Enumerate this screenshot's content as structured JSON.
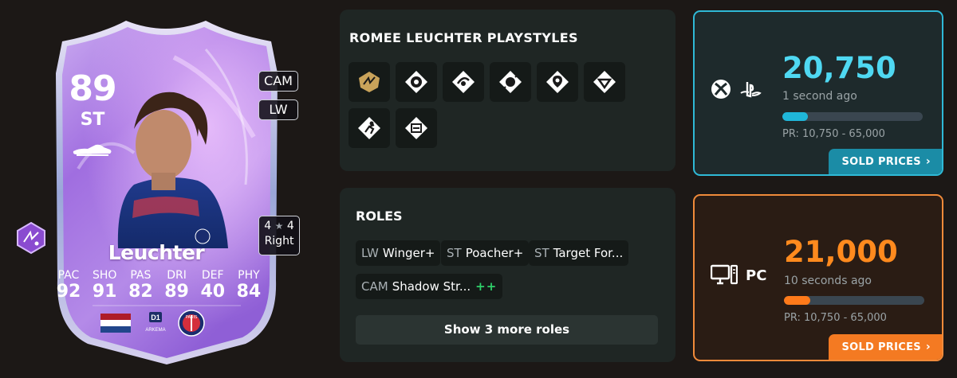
{
  "card": {
    "rating": "89",
    "position": "ST",
    "alt_positions": [
      "CAM",
      "LW"
    ],
    "skill_moves": "4",
    "weak_foot": "4",
    "star_glyph": "★",
    "foot": "Right",
    "name": "Leuchter",
    "stats": [
      {
        "label": "PAC",
        "value": "92"
      },
      {
        "label": "SHO",
        "value": "91"
      },
      {
        "label": "PAS",
        "value": "82"
      },
      {
        "label": "DRI",
        "value": "89"
      },
      {
        "label": "DEF",
        "value": "40"
      },
      {
        "label": "PHY",
        "value": "84"
      }
    ],
    "nation": "Netherlands flag",
    "league_logo_text": "D1 ARKEMA",
    "club_logo_text": "PARIS"
  },
  "playstyles": {
    "title": "ROMEE LEUCHTER PLAYSTYLES",
    "icons": [
      "playstyle-plus-gold-icon",
      "power-shot-icon",
      "finesse-shot-icon",
      "technical-icon",
      "rapid-icon",
      "trickster-icon",
      "acrobatic-icon",
      "first-touch-icon"
    ]
  },
  "roles": {
    "title": "ROLES",
    "items": [
      {
        "pos": "CAM",
        "role": "Shadow Str...",
        "plus": "++"
      },
      {
        "pos": "LW",
        "role": "Winger+",
        "plus": ""
      },
      {
        "pos": "ST",
        "role": "Poacher+",
        "plus": ""
      },
      {
        "pos": "ST",
        "role": "Target For...",
        "plus": ""
      }
    ],
    "more_label": "Show 3 more roles"
  },
  "console_price": {
    "platforms": [
      "xbox-icon",
      "playstation-icon"
    ],
    "price": "20,750",
    "updated": "1 second ago",
    "range": "PR: 10,750 - 65,000",
    "range_progress": 0.18,
    "sold_label": "SOLD PRICES",
    "accent": "#2fb9d6"
  },
  "pc_price": {
    "platform_label": "PC",
    "price": "21,000",
    "updated": "10 seconds ago",
    "range": "PR: 10,750 - 65,000",
    "range_progress": 0.19,
    "sold_label": "SOLD PRICES",
    "accent": "#f08a3a"
  }
}
